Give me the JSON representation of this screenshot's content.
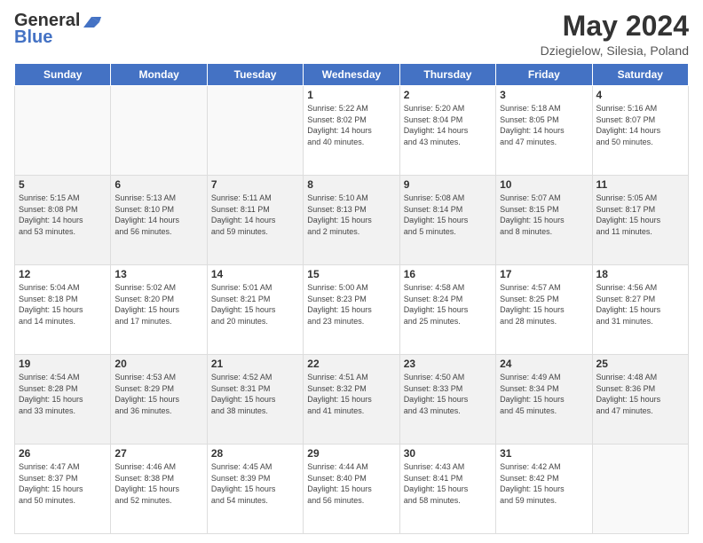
{
  "header": {
    "logo_line1": "General",
    "logo_line2": "Blue",
    "title": "May 2024",
    "subtitle": "Dziegielow, Silesia, Poland"
  },
  "weekdays": [
    "Sunday",
    "Monday",
    "Tuesday",
    "Wednesday",
    "Thursday",
    "Friday",
    "Saturday"
  ],
  "weeks": [
    [
      {
        "day": "",
        "info": ""
      },
      {
        "day": "",
        "info": ""
      },
      {
        "day": "",
        "info": ""
      },
      {
        "day": "1",
        "info": "Sunrise: 5:22 AM\nSunset: 8:02 PM\nDaylight: 14 hours\nand 40 minutes."
      },
      {
        "day": "2",
        "info": "Sunrise: 5:20 AM\nSunset: 8:04 PM\nDaylight: 14 hours\nand 43 minutes."
      },
      {
        "day": "3",
        "info": "Sunrise: 5:18 AM\nSunset: 8:05 PM\nDaylight: 14 hours\nand 47 minutes."
      },
      {
        "day": "4",
        "info": "Sunrise: 5:16 AM\nSunset: 8:07 PM\nDaylight: 14 hours\nand 50 minutes."
      }
    ],
    [
      {
        "day": "5",
        "info": "Sunrise: 5:15 AM\nSunset: 8:08 PM\nDaylight: 14 hours\nand 53 minutes."
      },
      {
        "day": "6",
        "info": "Sunrise: 5:13 AM\nSunset: 8:10 PM\nDaylight: 14 hours\nand 56 minutes."
      },
      {
        "day": "7",
        "info": "Sunrise: 5:11 AM\nSunset: 8:11 PM\nDaylight: 14 hours\nand 59 minutes."
      },
      {
        "day": "8",
        "info": "Sunrise: 5:10 AM\nSunset: 8:13 PM\nDaylight: 15 hours\nand 2 minutes."
      },
      {
        "day": "9",
        "info": "Sunrise: 5:08 AM\nSunset: 8:14 PM\nDaylight: 15 hours\nand 5 minutes."
      },
      {
        "day": "10",
        "info": "Sunrise: 5:07 AM\nSunset: 8:15 PM\nDaylight: 15 hours\nand 8 minutes."
      },
      {
        "day": "11",
        "info": "Sunrise: 5:05 AM\nSunset: 8:17 PM\nDaylight: 15 hours\nand 11 minutes."
      }
    ],
    [
      {
        "day": "12",
        "info": "Sunrise: 5:04 AM\nSunset: 8:18 PM\nDaylight: 15 hours\nand 14 minutes."
      },
      {
        "day": "13",
        "info": "Sunrise: 5:02 AM\nSunset: 8:20 PM\nDaylight: 15 hours\nand 17 minutes."
      },
      {
        "day": "14",
        "info": "Sunrise: 5:01 AM\nSunset: 8:21 PM\nDaylight: 15 hours\nand 20 minutes."
      },
      {
        "day": "15",
        "info": "Sunrise: 5:00 AM\nSunset: 8:23 PM\nDaylight: 15 hours\nand 23 minutes."
      },
      {
        "day": "16",
        "info": "Sunrise: 4:58 AM\nSunset: 8:24 PM\nDaylight: 15 hours\nand 25 minutes."
      },
      {
        "day": "17",
        "info": "Sunrise: 4:57 AM\nSunset: 8:25 PM\nDaylight: 15 hours\nand 28 minutes."
      },
      {
        "day": "18",
        "info": "Sunrise: 4:56 AM\nSunset: 8:27 PM\nDaylight: 15 hours\nand 31 minutes."
      }
    ],
    [
      {
        "day": "19",
        "info": "Sunrise: 4:54 AM\nSunset: 8:28 PM\nDaylight: 15 hours\nand 33 minutes."
      },
      {
        "day": "20",
        "info": "Sunrise: 4:53 AM\nSunset: 8:29 PM\nDaylight: 15 hours\nand 36 minutes."
      },
      {
        "day": "21",
        "info": "Sunrise: 4:52 AM\nSunset: 8:31 PM\nDaylight: 15 hours\nand 38 minutes."
      },
      {
        "day": "22",
        "info": "Sunrise: 4:51 AM\nSunset: 8:32 PM\nDaylight: 15 hours\nand 41 minutes."
      },
      {
        "day": "23",
        "info": "Sunrise: 4:50 AM\nSunset: 8:33 PM\nDaylight: 15 hours\nand 43 minutes."
      },
      {
        "day": "24",
        "info": "Sunrise: 4:49 AM\nSunset: 8:34 PM\nDaylight: 15 hours\nand 45 minutes."
      },
      {
        "day": "25",
        "info": "Sunrise: 4:48 AM\nSunset: 8:36 PM\nDaylight: 15 hours\nand 47 minutes."
      }
    ],
    [
      {
        "day": "26",
        "info": "Sunrise: 4:47 AM\nSunset: 8:37 PM\nDaylight: 15 hours\nand 50 minutes."
      },
      {
        "day": "27",
        "info": "Sunrise: 4:46 AM\nSunset: 8:38 PM\nDaylight: 15 hours\nand 52 minutes."
      },
      {
        "day": "28",
        "info": "Sunrise: 4:45 AM\nSunset: 8:39 PM\nDaylight: 15 hours\nand 54 minutes."
      },
      {
        "day": "29",
        "info": "Sunrise: 4:44 AM\nSunset: 8:40 PM\nDaylight: 15 hours\nand 56 minutes."
      },
      {
        "day": "30",
        "info": "Sunrise: 4:43 AM\nSunset: 8:41 PM\nDaylight: 15 hours\nand 58 minutes."
      },
      {
        "day": "31",
        "info": "Sunrise: 4:42 AM\nSunset: 8:42 PM\nDaylight: 15 hours\nand 59 minutes."
      },
      {
        "day": "",
        "info": ""
      }
    ]
  ]
}
